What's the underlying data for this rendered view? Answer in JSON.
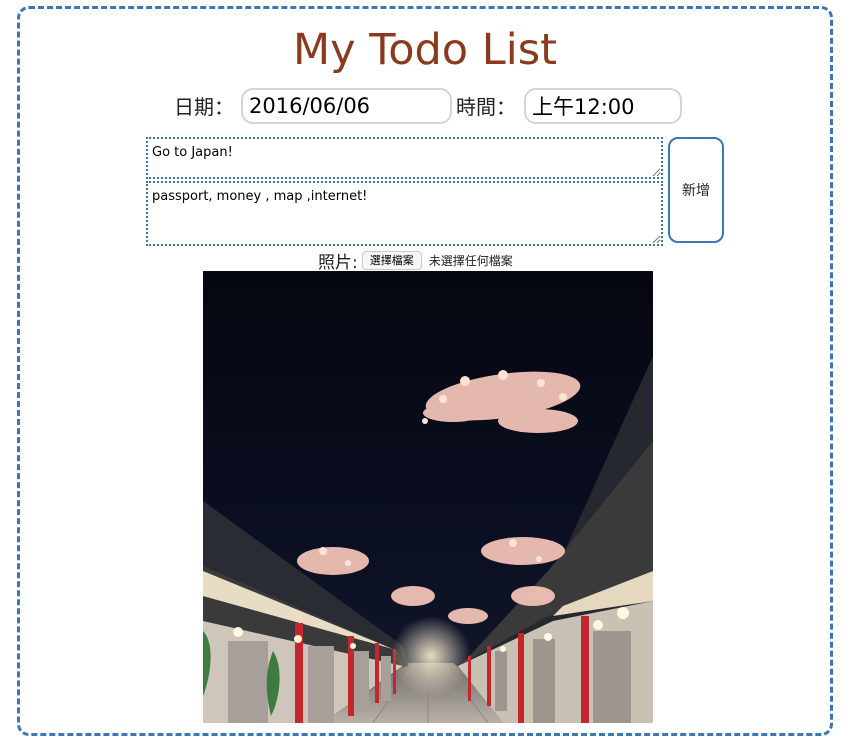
{
  "app": {
    "title": "My Todo List"
  },
  "form": {
    "date_label": "日期：",
    "date_value": "2016/06/06",
    "time_label": "時間：",
    "time_value": "上午12:00",
    "todo_title": "Go to Japan!",
    "todo_detail": "passport, money , map ,internet!",
    "add_label": "新增",
    "photo_label": "照片:",
    "file_button_label": "選擇檔案",
    "file_status": "未選擇任何檔案"
  },
  "photo": {
    "image": "night-street-cherry-blossom-photo"
  },
  "colors": {
    "title": "#8b3a1e",
    "border": "#3a77b3"
  }
}
